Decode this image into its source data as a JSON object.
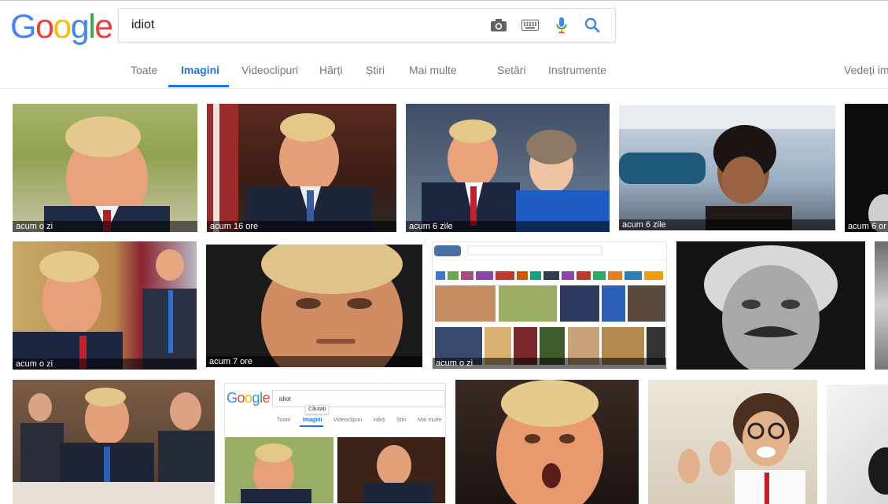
{
  "search": {
    "query": "idiot"
  },
  "tabs": [
    {
      "label": "Toate"
    },
    {
      "label": "Imagini"
    },
    {
      "label": "Videoclipuri"
    },
    {
      "label": "Hărți"
    },
    {
      "label": "Știri"
    },
    {
      "label": "Mai multe"
    },
    {
      "label": "Setări"
    },
    {
      "label": "Instrumente"
    }
  ],
  "view_link": "Vedeți ima",
  "results": [
    {
      "time": "acum o zi"
    },
    {
      "time": "acum 16 ore"
    },
    {
      "time": "acum 6 zile"
    },
    {
      "time": "acum 6 zile"
    },
    {
      "time": "acum 6 or"
    },
    {
      "time": "acum o zi"
    },
    {
      "time": "acum 7 ore"
    },
    {
      "time": "acum o zi"
    }
  ],
  "nested_screenshot": {
    "query": "idiot",
    "tooltip": "Căutați",
    "tabs": [
      "Toate",
      "Imagini",
      "Videoclipuri",
      "Hărți",
      "Știri",
      "Mai multe"
    ]
  },
  "colors": {
    "accent": "#1a73e8",
    "google_blue": "#4285f4",
    "google_red": "#ea4335",
    "google_yellow": "#fbbc05",
    "google_green": "#34a853"
  }
}
